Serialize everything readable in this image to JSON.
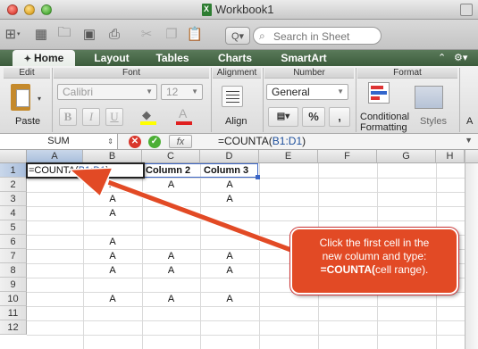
{
  "window": {
    "title": "Workbook1"
  },
  "search": {
    "placeholder": "Search in Sheet"
  },
  "ribbon_tabs": {
    "home": "Home",
    "layout": "Layout",
    "tables": "Tables",
    "charts": "Charts",
    "smartart": "SmartArt"
  },
  "ribbon": {
    "edit": "Edit",
    "paste": "Paste",
    "font": "Font",
    "font_name": "Calibri",
    "font_size": "12",
    "bold": "B",
    "italic": "I",
    "underline": "U",
    "font_color": "A",
    "alignment": "Alignment",
    "align": "Align",
    "number": "Number",
    "number_format": "General",
    "percent": "%",
    "comma": ",",
    "format": "Format",
    "conditional": "Conditional",
    "formatting": "Formatting",
    "styles": "Styles",
    "next_group": "A"
  },
  "formula_bar": {
    "name_box": "SUM",
    "fx": "fx",
    "formula_prefix": "=COUNTA(",
    "formula_ref": "B1:D1",
    "formula_suffix": ")"
  },
  "grid": {
    "columns": [
      "A",
      "B",
      "C",
      "D",
      "E",
      "F",
      "G",
      "H"
    ],
    "rows": [
      "1",
      "2",
      "3",
      "4",
      "5",
      "6",
      "7",
      "8",
      "9",
      "10",
      "11",
      "12"
    ],
    "active_cell": {
      "prefix": "=COUNTA(",
      "ref": "B1:D1",
      "suffix": ")"
    },
    "headers": {
      "c1": "Column 2",
      "d1": "Column 3"
    },
    "cell_value": "A"
  },
  "callout": {
    "line1": "Click the first cell in the",
    "line2": "new column and type:",
    "line3_bold": "=COUNTA(",
    "line3_rest": "cell range)."
  },
  "colors": {
    "accent": "#e24a25",
    "ribbon_tab": "#4a6a4a",
    "ref_blue": "#1d4f9c"
  }
}
